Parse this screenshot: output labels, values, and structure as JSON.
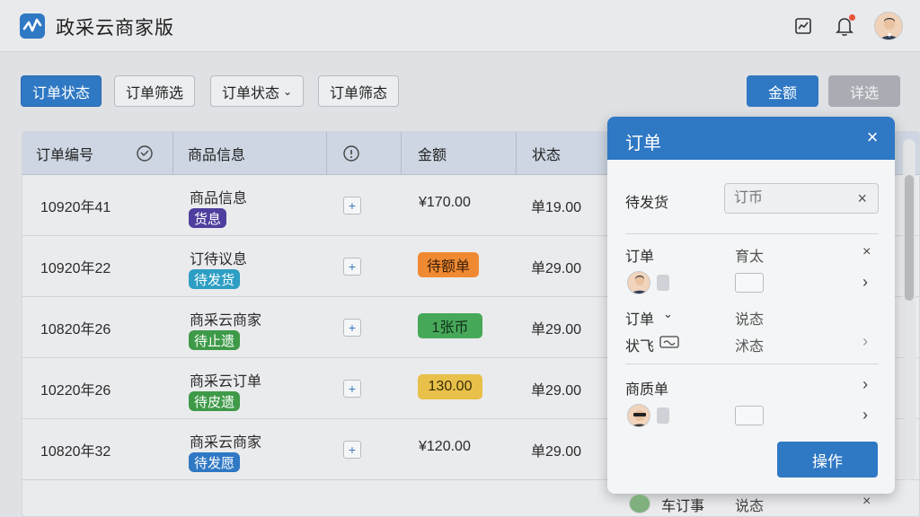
{
  "app": {
    "title": "政采云商家版"
  },
  "filters": [
    {
      "label": "订单状态",
      "active": true
    },
    {
      "label": "订单筛选",
      "active": false
    },
    {
      "label": "订单状态",
      "active": false,
      "dropdown": true
    },
    {
      "label": "订单筛态",
      "active": false
    }
  ],
  "actions": {
    "primary_label": "金额",
    "secondary_label": "详选"
  },
  "table": {
    "headers": {
      "order_no": "订单编号",
      "product": "商品信息",
      "amount": "金额",
      "status": "状态"
    },
    "rows": [
      {
        "id": "10920年41",
        "product": "商品信息",
        "tag": "货息",
        "tag_color": "#4e3f9e",
        "amount": "¥170.00",
        "amount_style": "plain",
        "status": "单19.00"
      },
      {
        "id": "10920年22",
        "product": "订待议息",
        "tag": "待发货",
        "tag_color": "#2d9ec4",
        "amount": "待额单",
        "amount_style": "orange",
        "status": "单29.00"
      },
      {
        "id": "10820年26",
        "product": "商采云商家",
        "tag": "待止遗",
        "tag_color": "#3e9a48",
        "amount": "1张币",
        "amount_style": "green",
        "status": "单29.00"
      },
      {
        "id": "10220年26",
        "product": "商采云订单",
        "tag": "待皮遗",
        "tag_color": "#3e9a48",
        "amount": "130.00",
        "amount_style": "yellow",
        "status": "单29.00"
      },
      {
        "id": "10820年32",
        "product": "商采云商家",
        "tag": "待发愿",
        "tag_color": "#2f78c4",
        "amount": "¥120.00",
        "amount_style": "plain",
        "status": "单29.00"
      }
    ]
  },
  "panel": {
    "title": "订单",
    "field_label": "待发货",
    "field_placeholder": "订币",
    "section1": {
      "left_title": "订单",
      "right_title": "育太",
      "row2_left": "订单",
      "row2_right": "说态",
      "row3_left": "状飞",
      "row3_right": "沭态"
    },
    "section2": {
      "title": "商质单"
    },
    "peek": {
      "left": "车订事",
      "right": "说态"
    },
    "footer_label": "操作"
  },
  "colors": {
    "accent": "#2f78c4",
    "orange": "#f08a32",
    "green": "#48a85a",
    "yellow": "#e8c04a"
  }
}
